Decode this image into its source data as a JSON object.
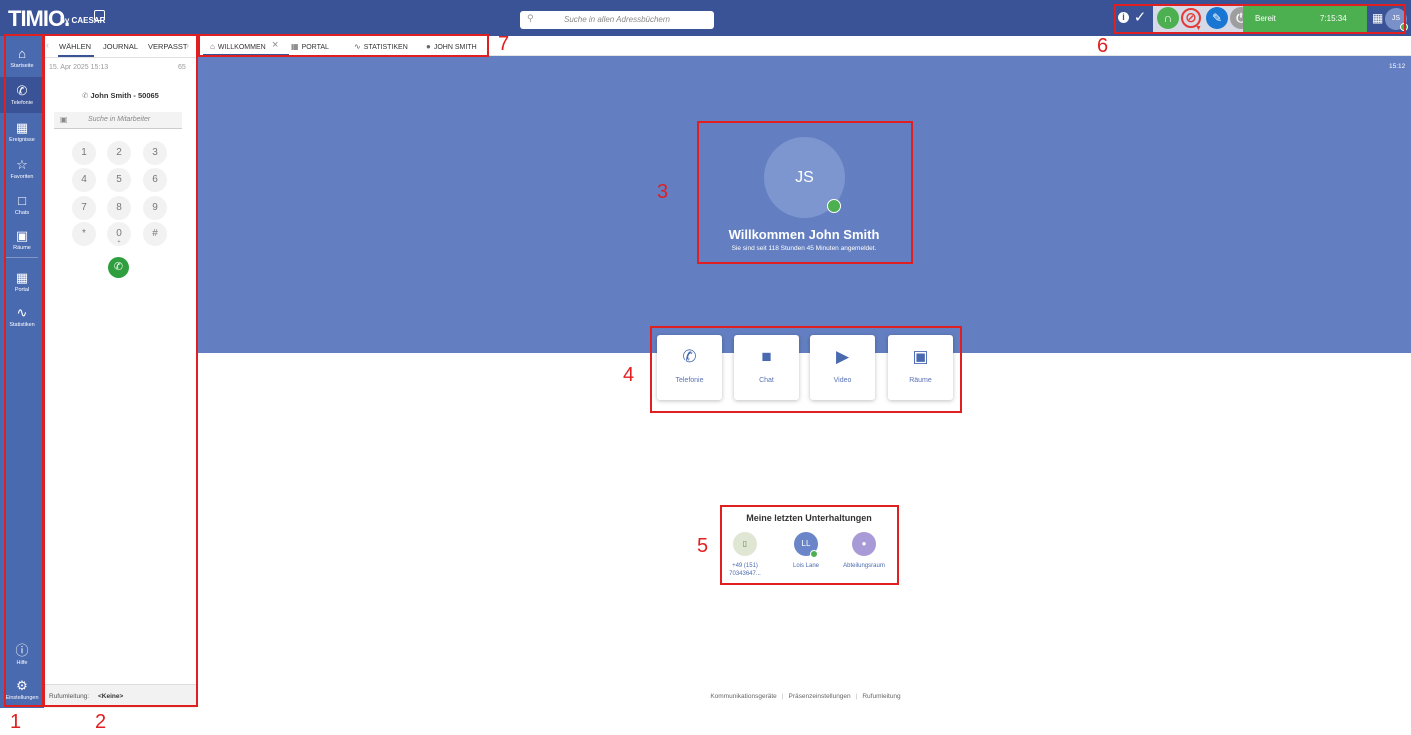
{
  "app": {
    "logo": "TIMIO.",
    "logo_by": "by CAESAR"
  },
  "search": {
    "placeholder": "Suche in allen Adressbüchern"
  },
  "status": {
    "label": "Bereit",
    "time": "7:15:34",
    "user_initials": "JS"
  },
  "nav": {
    "items": [
      {
        "label": "Startseite",
        "icon": "home-icon"
      },
      {
        "label": "Telefonie",
        "icon": "phone-icon"
      },
      {
        "label": "Ereignisse",
        "icon": "calendar-icon"
      },
      {
        "label": "Favoriten",
        "icon": "star-icon"
      },
      {
        "label": "Chats",
        "icon": "chat-icon"
      },
      {
        "label": "Räume",
        "icon": "rooms-icon"
      },
      {
        "label": "Portal",
        "icon": "grid-icon"
      },
      {
        "label": "Statistiken",
        "icon": "chart-icon"
      },
      {
        "label": "Hilfe",
        "icon": "help-icon"
      },
      {
        "label": "Einstellungen",
        "icon": "gear-icon"
      }
    ]
  },
  "dial": {
    "tabs": [
      "WÄHLEN",
      "JOURNAL",
      "VERPASST"
    ],
    "date": "15. Apr 2025  15:13",
    "count": "65",
    "contact": "John Smith - 50065",
    "search_placeholder": "Suche in Mitarbeiter",
    "keys": [
      "1",
      "2",
      "3",
      "4",
      "5",
      "6",
      "7",
      "8",
      "9",
      "*",
      "0",
      "#"
    ],
    "key_zero_sub": "+",
    "forwarding_label": "Rufumleitung:",
    "forwarding_value": "<Keine>"
  },
  "tabs": [
    {
      "label": "WILLKOMMEN",
      "icon": "home-icon"
    },
    {
      "label": "PORTAL",
      "icon": "grid-icon"
    },
    {
      "label": "STATISTIKEN",
      "icon": "chart-icon"
    },
    {
      "label": "JOHN SMITH",
      "icon": "user-icon"
    }
  ],
  "hero": {
    "time": "15:12",
    "initials": "JS",
    "title": "Willkommen John Smith",
    "subtitle": "Sie sind seit 118 Stunden 45 Minuten angemeldet."
  },
  "actions": [
    {
      "label": "Telefonie",
      "icon": "phone-icon"
    },
    {
      "label": "Chat",
      "icon": "chat-icon"
    },
    {
      "label": "Video",
      "icon": "video-icon"
    },
    {
      "label": "Räume",
      "icon": "rooms-icon"
    }
  ],
  "recent": {
    "title": "Meine letzten Unterhaltungen",
    "items": [
      {
        "label": "+49 (151) 70343647...",
        "icon": "mobile-icon"
      },
      {
        "label": "Lois Lane",
        "initials": "LL"
      },
      {
        "label": "Abteilungsraum",
        "icon": "group-icon"
      }
    ]
  },
  "footer": {
    "links": [
      "Kommunikationsgeräte",
      "Präsenzeinstellungen",
      "Rufumleitung"
    ]
  },
  "annotations": [
    "1",
    "2",
    "3",
    "4",
    "5",
    "6",
    "7"
  ],
  "colors": {
    "brand": "#3a5396",
    "hero": "#637fc1",
    "online": "#4caf50",
    "annotation": "#e02020"
  }
}
